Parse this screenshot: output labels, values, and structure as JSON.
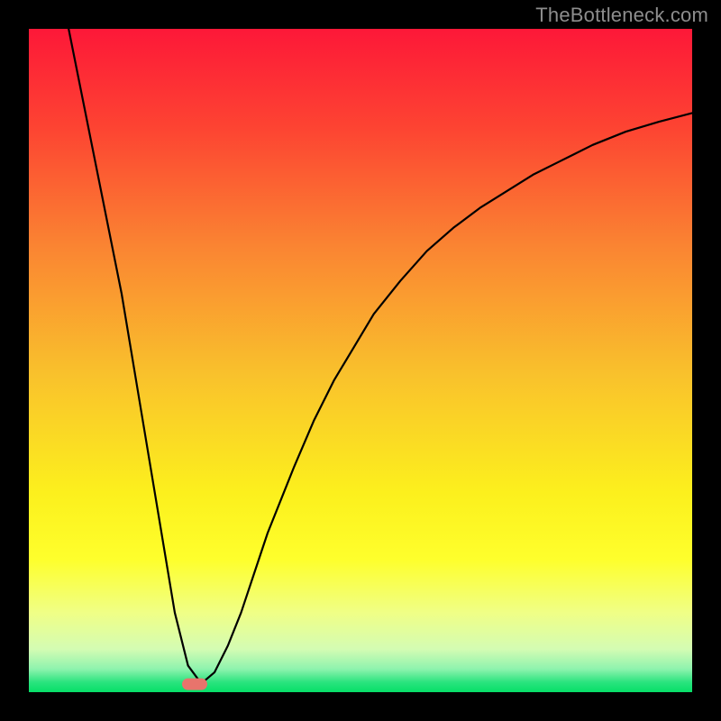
{
  "watermark": "TheBottleneck.com",
  "chart_data": {
    "type": "line",
    "title": "",
    "xlabel": "",
    "ylabel": "",
    "xlim": [
      0,
      100
    ],
    "ylim": [
      0,
      100
    ],
    "grid": false,
    "series": [
      {
        "name": "curve",
        "x": [
          6,
          10,
          14,
          17,
          20,
          22,
          24,
          26,
          28,
          30,
          32,
          34,
          36,
          38,
          40,
          43,
          46,
          49,
          52,
          56,
          60,
          64,
          68,
          72,
          76,
          80,
          85,
          90,
          95,
          100
        ],
        "y": [
          100,
          80,
          60,
          42,
          24,
          12,
          4,
          1.3,
          3,
          7,
          12,
          18,
          24,
          29,
          34,
          41,
          47,
          52,
          57,
          62,
          66.5,
          70,
          73,
          75.5,
          78,
          80,
          82.5,
          84.5,
          86,
          87.3
        ]
      }
    ],
    "marker": {
      "x": 25,
      "y": 1.2,
      "color": "#e8746c"
    },
    "gradient": {
      "stops": [
        {
          "offset": 0.0,
          "color": "#fd1838"
        },
        {
          "offset": 0.15,
          "color": "#fd4432"
        },
        {
          "offset": 0.33,
          "color": "#fa8532"
        },
        {
          "offset": 0.52,
          "color": "#f9c12c"
        },
        {
          "offset": 0.7,
          "color": "#fcf01d"
        },
        {
          "offset": 0.8,
          "color": "#feff2c"
        },
        {
          "offset": 0.88,
          "color": "#f0ff86"
        },
        {
          "offset": 0.935,
          "color": "#d4fcb3"
        },
        {
          "offset": 0.965,
          "color": "#8ef3ae"
        },
        {
          "offset": 0.985,
          "color": "#2ae47e"
        },
        {
          "offset": 1.0,
          "color": "#06df68"
        }
      ]
    },
    "frame": {
      "stroke": "#000000",
      "width": 32
    }
  }
}
